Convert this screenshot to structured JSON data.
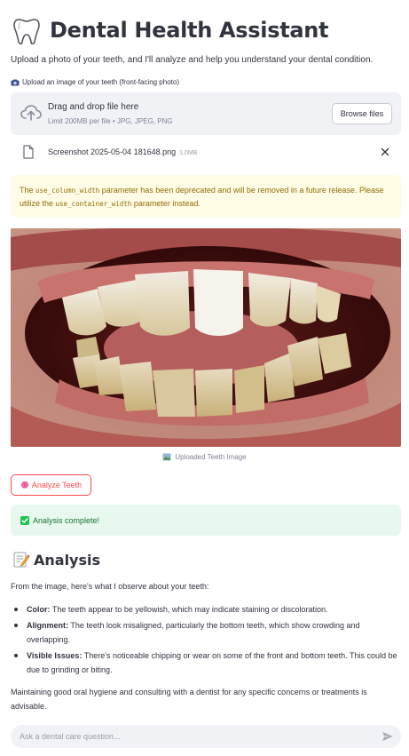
{
  "header": {
    "title": "Dental Health Assistant",
    "icon": "tooth-icon"
  },
  "intro": "Upload a photo of your teeth, and I'll analyze and help you understand your dental condition.",
  "uploader": {
    "label": "Upload an image of your teeth (front-facing photo)",
    "drop_text": "Drag and drop file here",
    "limit_text": "Limit 200MB per file • JPG, JPEG, PNG",
    "browse_label": "Browse files",
    "file": {
      "name": "Screenshot 2025-05-04 181648.png",
      "size": "1.0MB"
    }
  },
  "warning": {
    "text_1": "The ",
    "code_1": "use_column_width",
    "text_2": " parameter has been deprecated and will be removed in a future release. Please utilize the ",
    "code_2": "use_container_width",
    "text_3": " parameter instead."
  },
  "image": {
    "caption": "Uploaded Teeth Image"
  },
  "analyze_button": "Analyze Teeth",
  "success_message": "Analysis complete!",
  "analysis": {
    "title": "Analysis",
    "intro": "From the image, here's what I observe about your teeth:",
    "bullets": [
      {
        "label": "Color:",
        "text": " The teeth appear to be yellowish, which may indicate staining or discoloration."
      },
      {
        "label": "Alignment:",
        "text": " The teeth look misaligned, particularly the bottom teeth, which show crowding and overlapping."
      },
      {
        "label": "Visible Issues:",
        "text": " There's noticeable chipping or wear on some of the front and bottom teeth. This could be due to grinding or biting."
      }
    ],
    "closing": "Maintaining good oral hygiene and consulting with a dentist for any specific concerns or treatments is advisable."
  },
  "chat": {
    "placeholder": "Ask a dental care question..."
  },
  "colors": {
    "accent": "#ff4b4b",
    "success_bg": "#e9f8ee",
    "success_text": "#177233",
    "warning_bg": "#fffce6",
    "warning_text": "#926c05"
  }
}
